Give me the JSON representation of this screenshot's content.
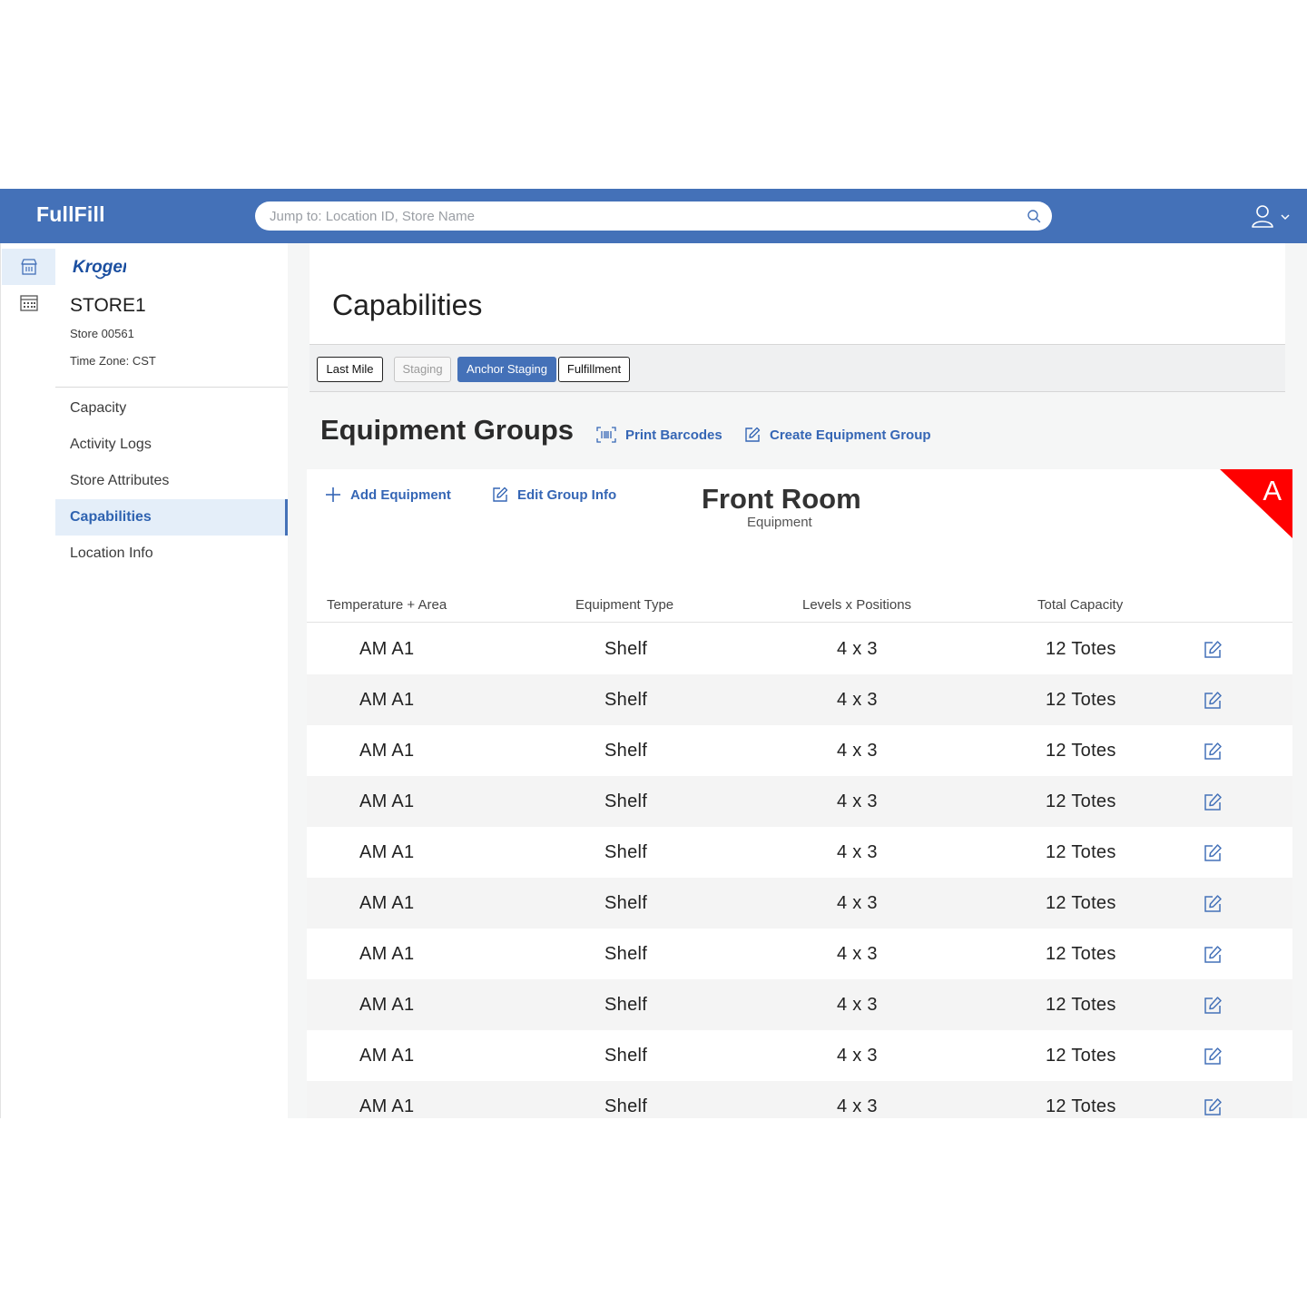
{
  "app": {
    "brand": "FullFill"
  },
  "search": {
    "placeholder": "Jump to: Location ID, Store Name"
  },
  "store": {
    "logo_text": "Kroger",
    "name": "STORE1",
    "store_id": "Store 00561",
    "timezone": "Time Zone: CST"
  },
  "nav": [
    {
      "label": "Capacity"
    },
    {
      "label": "Activity Logs"
    },
    {
      "label": "Store Attributes"
    },
    {
      "label": "Capabilities",
      "active": true
    },
    {
      "label": "Location Info"
    }
  ],
  "page": {
    "title": "Capabilities"
  },
  "tabs": [
    {
      "label": "Last Mile",
      "state": "outline"
    },
    {
      "label": "Staging",
      "state": "disabled"
    },
    {
      "label": "Anchor Staging",
      "state": "selected"
    },
    {
      "label": "Fulfillment",
      "state": "outline"
    }
  ],
  "section": {
    "title": "Equipment Groups",
    "print_barcodes": "Print Barcodes",
    "create_group": "Create Equipment Group"
  },
  "group": {
    "add_equipment": "Add Equipment",
    "edit_group_info": "Edit Group Info",
    "title": "Front Room",
    "subtitle": "Equipment",
    "badge": "A",
    "badge_color": "#ff0000",
    "columns": [
      "Temperature + Area",
      "Equipment Type",
      "Levels x Positions",
      "Total Capacity"
    ],
    "rows": [
      {
        "area": "AM A1",
        "type": "Shelf",
        "levels": "4 x 3",
        "capacity": "12 Totes"
      },
      {
        "area": "AM A1",
        "type": "Shelf",
        "levels": "4 x 3",
        "capacity": "12 Totes"
      },
      {
        "area": "AM A1",
        "type": "Shelf",
        "levels": "4 x 3",
        "capacity": "12 Totes"
      },
      {
        "area": "AM A1",
        "type": "Shelf",
        "levels": "4 x 3",
        "capacity": "12 Totes"
      },
      {
        "area": "AM A1",
        "type": "Shelf",
        "levels": "4 x 3",
        "capacity": "12 Totes"
      },
      {
        "area": "AM A1",
        "type": "Shelf",
        "levels": "4 x 3",
        "capacity": "12 Totes"
      },
      {
        "area": "AM A1",
        "type": "Shelf",
        "levels": "4 x 3",
        "capacity": "12 Totes"
      },
      {
        "area": "AM A1",
        "type": "Shelf",
        "levels": "4 x 3",
        "capacity": "12 Totes"
      },
      {
        "area": "AM A1",
        "type": "Shelf",
        "levels": "4 x 3",
        "capacity": "12 Totes"
      },
      {
        "area": "AM A1",
        "type": "Shelf",
        "levels": "4 x 3",
        "capacity": "12 Totes"
      }
    ]
  },
  "colors": {
    "primary": "#4471b8",
    "link": "#3566b5",
    "nav_active_bg": "#e4eef9"
  },
  "icons": {
    "rail": [
      "store-icon",
      "calendar-icon"
    ],
    "header": [
      "search-icon",
      "user-icon",
      "chevron-down-icon"
    ],
    "actions": [
      "barcode-icon",
      "edit-icon",
      "plus-icon"
    ]
  }
}
